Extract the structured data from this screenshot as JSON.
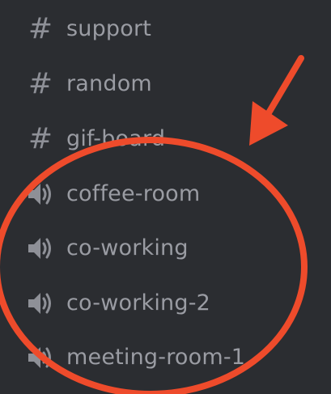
{
  "sidebar": {
    "text_channels": [
      {
        "name": "support",
        "icon": "hash-icon"
      },
      {
        "name": "random",
        "icon": "hash-icon"
      },
      {
        "name": "gif-board",
        "icon": "hash-icon"
      }
    ],
    "voice_channels": [
      {
        "name": "coffee-room",
        "icon": "speaker-icon"
      },
      {
        "name": "co-working",
        "icon": "speaker-icon"
      },
      {
        "name": "co-working-2",
        "icon": "speaker-icon"
      },
      {
        "name": "meeting-room-1",
        "icon": "speaker-icon"
      }
    ]
  },
  "colors": {
    "background": "#2b2d31",
    "channel_text": "#9a9ca3",
    "icon": "#8e9097",
    "annotation": "#ee4b2b"
  }
}
